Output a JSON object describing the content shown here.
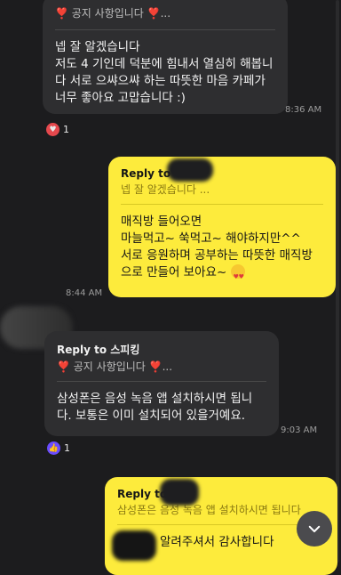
{
  "messages": [
    {
      "id": "m1",
      "quote": "❣️ 공지 사항입니다 ❣️...",
      "text": "넵 잘 알겠습니다\n저도 4 기인데 덕분에 힘내서 열심히 해봅니다 서로 으쌰으쌰 하는 따뜻한 마음 카페가 너무 좋아요 고맙습니다 :)",
      "time": "8:36 AM",
      "reaction": {
        "icon": "heart-icon",
        "count": "1",
        "color": "#e5484d"
      }
    },
    {
      "id": "m2",
      "reply_to": "Reply to",
      "quote": "넵 잘 알겠습니다 ...",
      "text": "매직방 들어오면\n마늘먹고~ 쑥먹고~ 해야하지만^^\n서로 응원하며 공부하는 따뜻한 매직방으로 만들어 보아요~",
      "time": "8:44 AM"
    },
    {
      "id": "m3",
      "reply_to": "Reply to 스피킹",
      "quote": "❣️ 공지 사항입니다 ❣️...",
      "text": "삼성폰은 음성 녹음 앱 설치하시면 됩니다. 보통은 이미 설치되어 있을거예요.",
      "time": "9:03 AM",
      "reaction": {
        "icon": "thumbs-up-icon",
        "count": "1",
        "color": "#6a4cff"
      }
    },
    {
      "id": "m4",
      "reply_to": "Reply to",
      "quote": "삼성폰은 음성 녹음 앱 설치하시면 됩니다",
      "text": "알려주셔서 감사합니다"
    }
  ],
  "colors": {
    "incoming": "#2e2e30",
    "outgoing": "#fdeb3c",
    "background": "#1c1c1e"
  },
  "fab": {
    "icon": "chevron-down-icon"
  }
}
